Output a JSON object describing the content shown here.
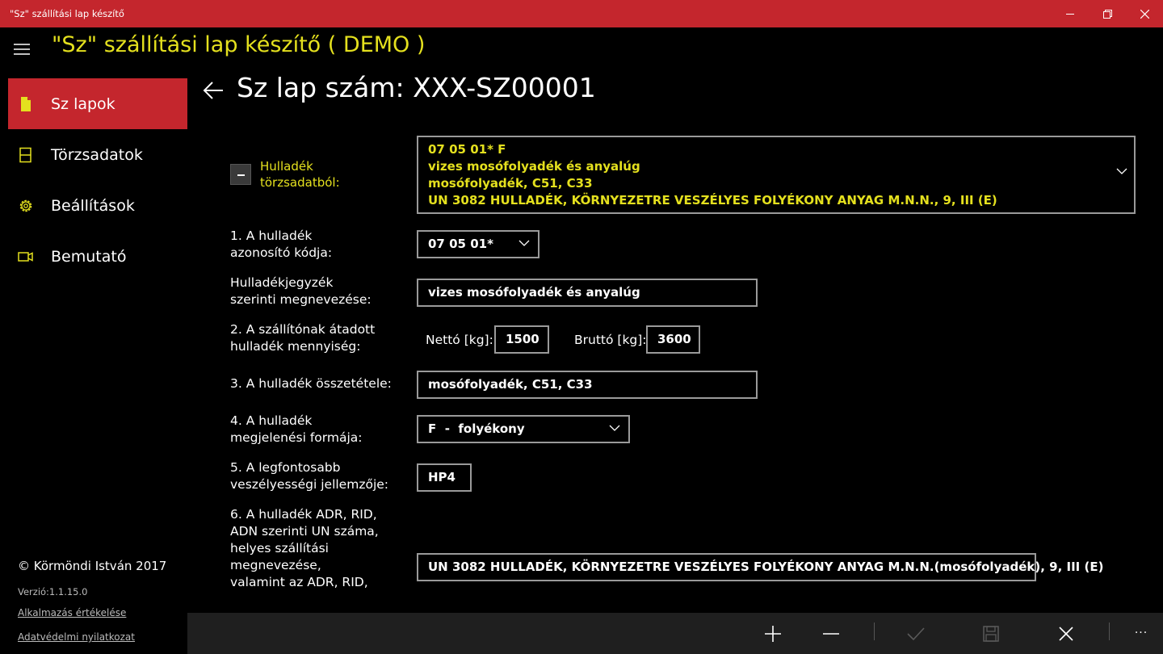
{
  "window": {
    "title": "\"Sz\" szállítási lap készítő",
    "accent_color": "#c4262d"
  },
  "app": {
    "title": "\"Sz\" szállítási lap készítő ( DEMO )",
    "title_color": "#e4e01e"
  },
  "nav": {
    "items": [
      {
        "label": "Sz lapok",
        "icon": "document-icon",
        "active": true
      },
      {
        "label": "Törzsadatok",
        "icon": "database-icon",
        "active": false
      },
      {
        "label": "Beállítások",
        "icon": "gear-icon",
        "active": false
      },
      {
        "label": "Bemutató",
        "icon": "video-icon",
        "active": false
      }
    ],
    "copyright": "© Körmöndi István 2017",
    "version": "Verzió:1.1.15.0",
    "rate_link": "Alkalmazás értékelése",
    "privacy_link": "Adatvédelmi nyilatkozat"
  },
  "page": {
    "title": "Sz lap szám: XXX-SZ00001"
  },
  "form": {
    "master": {
      "label_line1": "Hulladék",
      "label_line2": "törzsadatból:",
      "lines": [
        "07 05 01*        F",
        "vizes mosófolyadék és anyalúg",
        "mosófolyadék, C51, C33",
        "UN 3082 HULLADÉK, KÖRNYEZETRE VESZÉLYES FOLYÉKONY ANYAG M.N.N., 9, III (E)"
      ]
    },
    "code": {
      "label_line1": "1. A hulladék",
      "label_line2": "azonosító kódja:",
      "value": "07 05 01*"
    },
    "name": {
      "label_line1": "Hulladékjegyzék",
      "label_line2": "szerinti megnevezése:",
      "value": "vizes mosófolyadék és anyalúg"
    },
    "quantity": {
      "label_line1": "2. A szállítónak átadott",
      "label_line2": "hulladék mennyiség:",
      "net_label": "Nettó [kg]:",
      "net_value": "1500",
      "gross_label": "Bruttó [kg]:",
      "gross_value": "3600"
    },
    "composition": {
      "label": "3. A hulladék összetétele:",
      "value": "mosófolyadék, C51, C33"
    },
    "form_type": {
      "label_line1": "4. A hulladék",
      "label_line2": "megjelenési formája:",
      "value": "F  -  folyékony"
    },
    "hazard": {
      "label_line1": "5. A legfontosabb",
      "label_line2": "veszélyességi jellemzője:",
      "value": "HP4"
    },
    "un": {
      "label_lines": [
        "6. A hulladék ADR, RID,",
        "ADN szerinti UN száma,",
        "helyes szállítási",
        "megnevezése,",
        "valamint az ADR, RID,"
      ],
      "value": "UN 3082 HULLADÉK, KÖRNYEZETRE VESZÉLYES FOLYÉKONY ANYAG M.N.N.(mosófolyadék), 9, III (E)"
    }
  },
  "commands": {
    "items": [
      {
        "icon": "plus-icon",
        "enabled": true
      },
      {
        "icon": "minus-icon",
        "enabled": true
      },
      {
        "icon": "check-icon",
        "enabled": false
      },
      {
        "icon": "save-icon",
        "enabled": false
      },
      {
        "icon": "close-icon",
        "enabled": true
      }
    ],
    "more": "..."
  }
}
